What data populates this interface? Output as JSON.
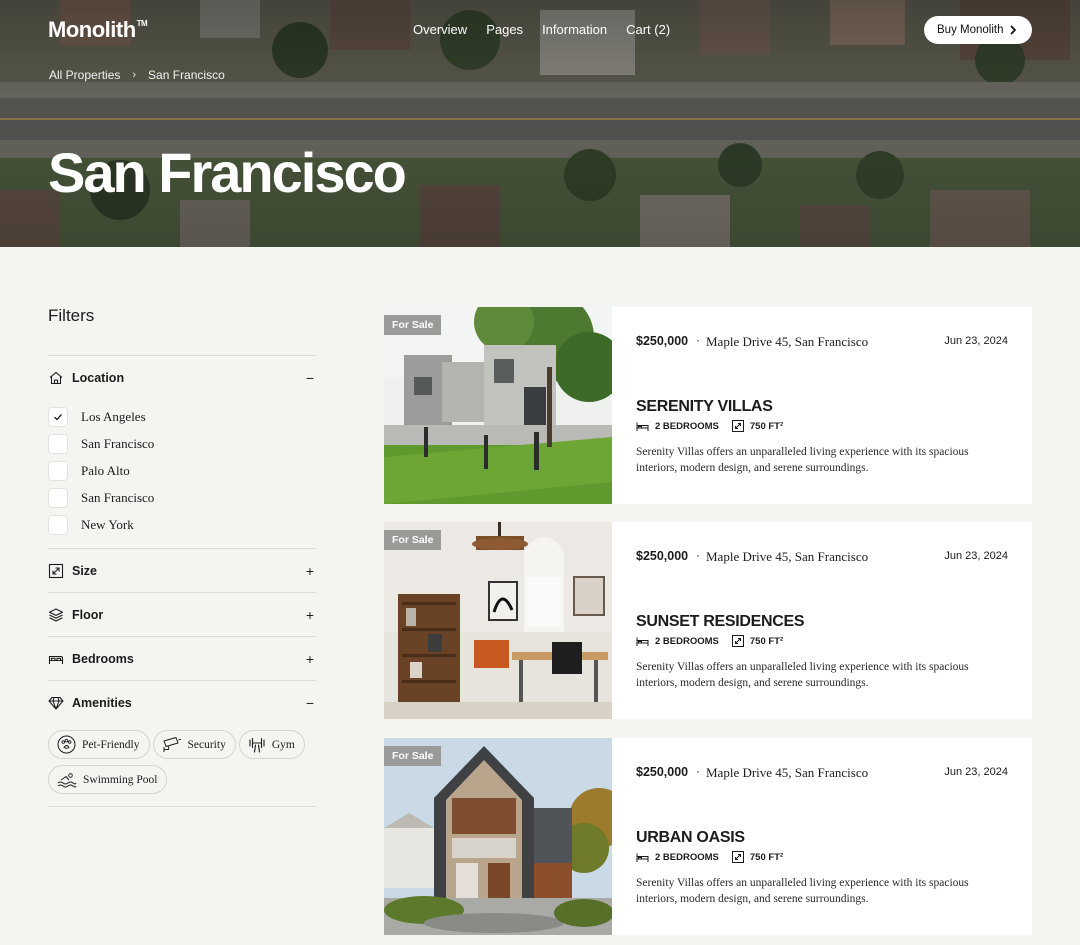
{
  "brand": {
    "name": "Monolith",
    "mark": "TM"
  },
  "nav": {
    "items": [
      "Overview",
      "Pages",
      "Information",
      "Cart (2)"
    ]
  },
  "buy_button": {
    "label": "Buy Monolith"
  },
  "breadcrumb": [
    "All Properties",
    "San Francisco"
  ],
  "hero": {
    "title": "San Francisco"
  },
  "filters": {
    "title": "Filters",
    "location": {
      "label": "Location",
      "toggle": "−",
      "options": [
        {
          "label": "Los Angeles",
          "checked": true
        },
        {
          "label": "San Francisco",
          "checked": false
        },
        {
          "label": "Palo Alto",
          "checked": false
        },
        {
          "label": "San Francisco",
          "checked": false
        },
        {
          "label": "New York",
          "checked": false
        }
      ]
    },
    "size": {
      "label": "Size",
      "toggle": "+"
    },
    "floor": {
      "label": "Floor",
      "toggle": "+"
    },
    "bedrooms": {
      "label": "Bedrooms",
      "toggle": "+"
    },
    "amenities": {
      "label": "Amenities",
      "toggle": "−",
      "chips": [
        "Pet-Friendly",
        "Security",
        "Gym",
        "Swimming Pool"
      ]
    }
  },
  "listings": [
    {
      "badge": "For Sale",
      "price": "$250,000",
      "separator": "·",
      "address": "Maple Drive 45, San Francisco",
      "date": "Jun 23, 2024",
      "name": "SERENITY VILLAS",
      "bedrooms": "2 BEDROOMS",
      "area": "750 FT²",
      "description": "Serenity Villas offers an unparalleled living experience with its spacious interiors, modern design, and serene surroundings."
    },
    {
      "badge": "For Sale",
      "price": "$250,000",
      "separator": "·",
      "address": "Maple Drive 45, San Francisco",
      "date": "Jun 23, 2024",
      "name": "SUNSET RESIDENCES",
      "bedrooms": "2 BEDROOMS",
      "area": "750 FT²",
      "description": "Serenity Villas offers an unparalleled living experience with its spacious interiors, modern design, and serene surroundings."
    },
    {
      "badge": "For Sale",
      "price": "$250,000",
      "separator": "·",
      "address": "Maple Drive 45, San Francisco",
      "date": "Jun 23, 2024",
      "name": "URBAN OASIS",
      "bedrooms": "2 BEDROOMS",
      "area": "750 FT²",
      "description": "Serenity Villas offers an unparalleled living experience with its spacious interiors, modern design, and serene surroundings."
    }
  ],
  "icons": {
    "location": "house-icon",
    "size": "resize-icon",
    "floor": "layers-icon",
    "bedrooms": "bed-icon",
    "amenities": "diamond-icon",
    "chips": [
      "paw-icon",
      "camera-icon",
      "dumbbell-icon",
      "waves-icon"
    ]
  }
}
